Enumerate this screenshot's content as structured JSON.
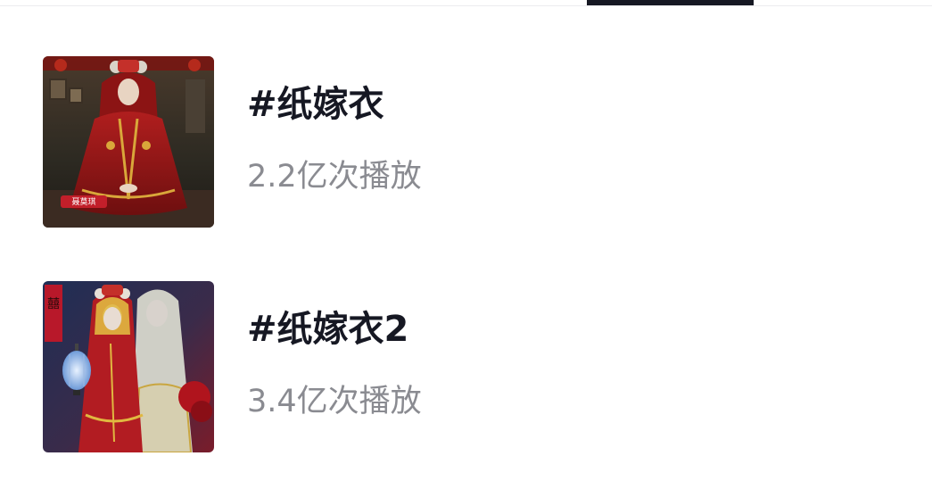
{
  "topics": [
    {
      "title": "#纸嫁衣",
      "plays": "2.2亿次播放",
      "thumbnail": {
        "icon": "bride-red-dress-image",
        "badge_text": "聂莫琪"
      }
    },
    {
      "title": "#纸嫁衣2",
      "plays": "3.4亿次播放",
      "thumbnail": {
        "icon": "two-brides-lantern-image",
        "side_text": "囍"
      }
    }
  ],
  "colors": {
    "title": "#161823",
    "subtitle": "#8a8b91",
    "tab_indicator": "#161823",
    "divider": "#ececee"
  }
}
